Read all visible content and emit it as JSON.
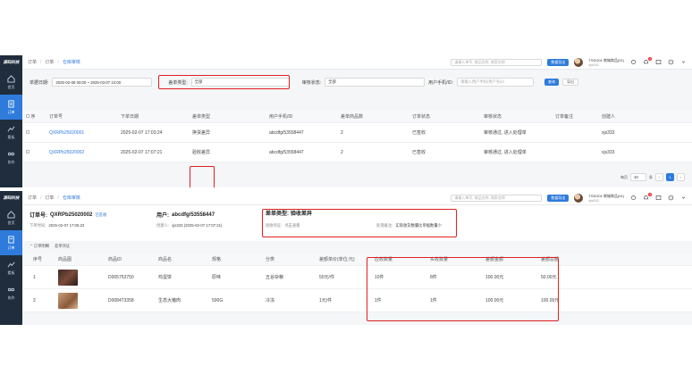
{
  "sidebar": {
    "logo": "源码科技",
    "items": [
      {
        "label": "首页",
        "icon": "home-icon",
        "active": false
      },
      {
        "label": "订单",
        "icon": "order-icon",
        "active": true
      },
      {
        "label": "看板",
        "icon": "chart-icon",
        "active": false
      },
      {
        "label": "协作",
        "icon": "share-icon",
        "active": false
      }
    ]
  },
  "topbar": {
    "breadcrumb": [
      "订单",
      "订单",
      "仓库审核"
    ],
    "search_placeholder": "请输入单号, 商品名称, 商家名称",
    "primary_btn": "数据导出",
    "user_name": "TSSO01 商城商品(01)",
    "user_sub": "xjs001",
    "bell_badge": "9"
  },
  "panel1": {
    "filters": {
      "date_label": "单据日期:",
      "date_value": "2025-02-08 00:00 ~ 2025-03-07 24:00",
      "type_label": "差单类型:",
      "type_value": "全部",
      "status_label": "审核状态:",
      "status_value": "全部",
      "user_label": "用户手机/ID:",
      "user_placeholder": "请输入用户手机/用户名/id",
      "query_btn": "查询",
      "reset_btn": "导出"
    },
    "columns": [
      "序",
      "订单号",
      "下单日期",
      "差单类型",
      "用户手机/ID",
      "差单商品数",
      "订单状态",
      "审核状态",
      "订单备注",
      "创建人"
    ],
    "rows": [
      {
        "order_no": "QXRPb25020001",
        "date": "2025-02-07 17:03:24",
        "type": "换货差异",
        "user": "abcdfg/53558447",
        "count": "2",
        "status": "已签收",
        "review": "审核通过, 进入处理单",
        "remark": "",
        "creator": "xjs333"
      },
      {
        "order_no": "QXRPb25020002",
        "date": "2025-02-07 17:07:21",
        "type": "验收差异",
        "user": "abcdfg/53558447",
        "count": "2",
        "status": "已签收",
        "review": "审核通过, 进入处理单",
        "remark": "",
        "creator": "xjs333"
      }
    ],
    "pager": {
      "size_label": "每页",
      "size": "10",
      "unit": "条",
      "page": "1"
    }
  },
  "panel2": {
    "order_label": "订单号:",
    "order_no": "QXRPb25020002",
    "order_status": "已签收",
    "order_date_label": "下单时间:",
    "order_date": "2025-02-07 17:06:23",
    "user_label": "用户:",
    "user_value": "abcdfg/53558447",
    "creator_label": "创建人:",
    "creator_value": "xjs333 (2025-02-07 17:07:21)",
    "diff_type_label": "差单类型:",
    "diff_type_value": "验收差异",
    "proof_label": "验收凭证:",
    "proof_link": "点击查看",
    "remark_label": "处理备注:",
    "remark_value": "实际收货数量比单据数量少",
    "tabs": [
      "订单明细",
      "差单凭证"
    ],
    "columns": [
      "序号",
      "商品图",
      "商品ID",
      "商品名",
      "规格",
      "分类",
      "差额单价(单位:元)",
      "应收数量",
      "实收数量",
      "差额金额",
      "差额总额"
    ],
    "rows": [
      {
        "no": "1",
        "sku": "D005753750",
        "name": "鸡蛋饼",
        "spec": "原味",
        "cat": "五谷杂粮",
        "price": "50元/件",
        "due": "10件",
        "got": "8件",
        "diff": "100.00元",
        "total": "50.00元"
      },
      {
        "no": "2",
        "sku": "D008473358",
        "name": "生态大猪肉",
        "spec": "500G",
        "cat": "冷冻",
        "price": "1元/件",
        "due": "1件",
        "got": "1件",
        "diff": "100.00元",
        "total": "100.00元"
      }
    ]
  }
}
